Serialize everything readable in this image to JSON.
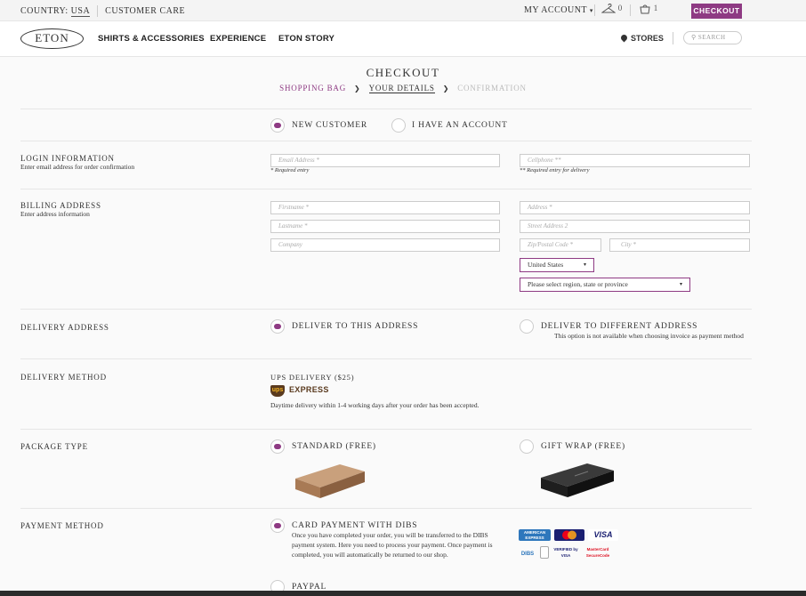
{
  "topbar": {
    "country_label": "COUNTRY:",
    "country_value": "USA",
    "customer_care": "CUSTOMER CARE",
    "my_account": "MY ACCOUNT",
    "wishlist_count": "0",
    "bag_count": "1",
    "checkout": "CHECKOUT"
  },
  "nav": {
    "logo": "ETON",
    "items": [
      "SHIRTS & ACCESSORIES",
      "EXPERIENCE",
      "ETON STORY"
    ],
    "stores": "STORES",
    "search_placeholder": "SEARCH"
  },
  "page": {
    "title": "CHECKOUT",
    "steps": [
      "SHOPPING BAG",
      "YOUR DETAILS",
      "CONFIRMATION"
    ]
  },
  "customer_type": {
    "new": "NEW CUSTOMER",
    "existing": "I HAVE AN ACCOUNT"
  },
  "login": {
    "title": "LOGIN INFORMATION",
    "subtitle": "Enter email address for order confirmation",
    "email_placeholder": "Email Address *",
    "email_hint": "* Required entry",
    "phone_placeholder": "Cellphone **",
    "phone_hint": "** Required entry for delivery"
  },
  "billing": {
    "title": "BILLING ADDRESS",
    "subtitle": "Enter address information",
    "firstname": "Firstname *",
    "lastname": "Lastname *",
    "company": "Company",
    "address": "Address *",
    "street2": "Street Address 2",
    "zip": "Zip/Postal Code *",
    "city": "City *",
    "country": "United States",
    "region": "Please select region, state or province"
  },
  "delivery_address": {
    "title": "DELIVERY ADDRESS",
    "this": "DELIVER TO THIS ADDRESS",
    "different": "DELIVER TO DIFFERENT ADDRESS",
    "different_note": "This option is not available when choosing invoice as payment method"
  },
  "delivery_method": {
    "title": "DELIVERY METHOD",
    "name": "UPS DELIVERY ($25)",
    "logo_text": "ups",
    "express": "EXPRESS",
    "note": "Daytime delivery within 1-4 working days after your order has been accepted."
  },
  "package": {
    "title": "PACKAGE TYPE",
    "standard": "STANDARD (FREE)",
    "gift": "GIFT WRAP (FREE)"
  },
  "payment": {
    "title": "PAYMENT METHOD",
    "card": "CARD PAYMENT WITH DIBS",
    "card_note": "Once you have completed your order, you will be transferred to the DIBS payment system. Here you need to process your payment. Once payment is completed, you will automatically be returned to our shop.",
    "paypal": "PAYPAL",
    "logos": {
      "amex": "AMERICAN EXPRESS",
      "mastercard": "MasterCard",
      "visa": "VISA",
      "dibs": "DIBS",
      "verified": "VERIFIED by VISA",
      "securecode": "MasterCard SecureCode"
    }
  },
  "colors": {
    "accent": "#8e3a83",
    "ups_brown": "#5a3a1e",
    "ups_gold": "#f2b324"
  }
}
